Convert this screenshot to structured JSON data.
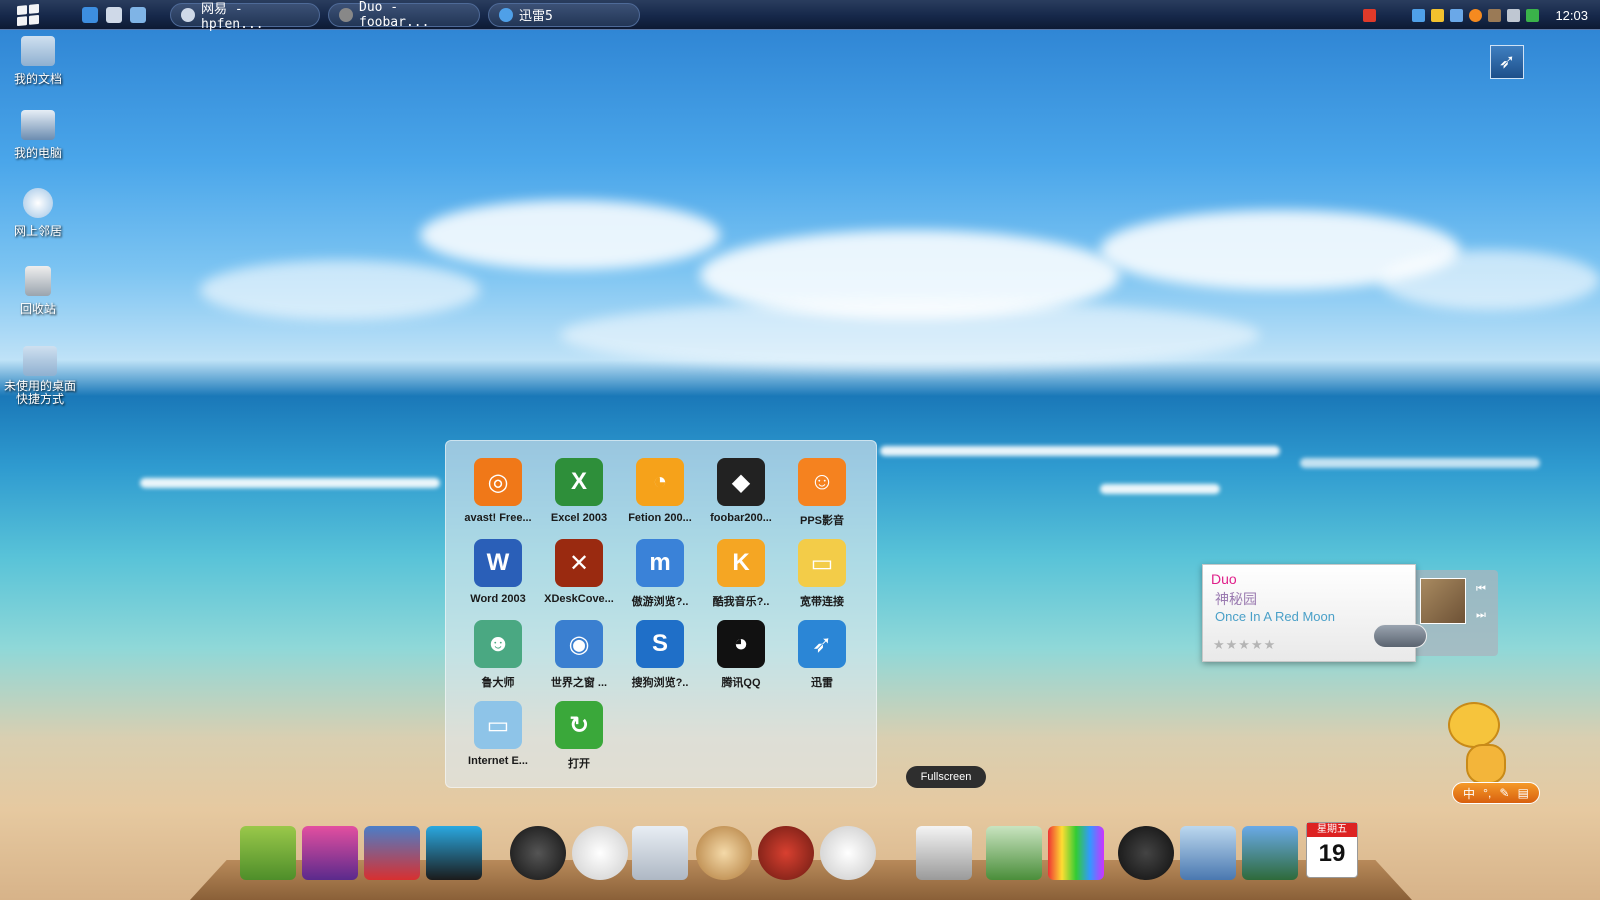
{
  "taskbar": {
    "tasks": [
      {
        "label": "网易 - hpfen..."
      },
      {
        "label": "Duo - foobar..."
      },
      {
        "label": "迅雷5"
      }
    ],
    "clock": "12:03"
  },
  "desktop": {
    "icons": [
      {
        "label": "我的文档"
      },
      {
        "label": "我的电脑"
      },
      {
        "label": "网上邻居"
      },
      {
        "label": "回收站"
      },
      {
        "label": "未使用的桌面快捷方式"
      }
    ]
  },
  "launcher": {
    "apps": [
      {
        "label": "avast! Free...",
        "color": "#f07818"
      },
      {
        "label": "Excel 2003",
        "color": "#2e8f3a"
      },
      {
        "label": "Fetion 200...",
        "color": "#f6a21a"
      },
      {
        "label": "foobar200...",
        "color": "#222222"
      },
      {
        "label": "PPS影音",
        "color": "#f5821f"
      },
      {
        "label": "Word 2003",
        "color": "#2a5fb8"
      },
      {
        "label": "XDeskCove...",
        "color": "#9a2a10"
      },
      {
        "label": "傲游浏览?..",
        "color": "#3a82d8"
      },
      {
        "label": "酷我音乐?..",
        "color": "#f5a623"
      },
      {
        "label": "宽带连接",
        "color": "#f3cc48"
      },
      {
        "label": "鲁大师",
        "color": "#4aa882"
      },
      {
        "label": "世界之窗 ...",
        "color": "#3a7fd0"
      },
      {
        "label": "搜狗浏览?..",
        "color": "#1f6fc8"
      },
      {
        "label": "腾讯QQ",
        "color": "#111111"
      },
      {
        "label": "迅雷",
        "color": "#2b86d6"
      },
      {
        "label": "Internet E...",
        "color": "#8ec4e8"
      },
      {
        "label": "打开",
        "color": "#3aa83a"
      }
    ]
  },
  "music": {
    "artist": "Duo",
    "album": "神秘园",
    "song": "Once In A Red Moon",
    "rating_stars": "★★★★★"
  },
  "ime": {
    "label": "中"
  },
  "dock": {
    "tooltip": "Fullscreen",
    "calendar_day": "19",
    "calendar_header": "星期五"
  }
}
